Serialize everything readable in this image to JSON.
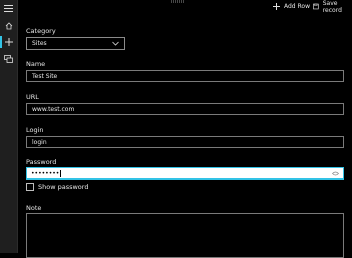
{
  "toolbar": {
    "add_row_label": "Add Row",
    "save_record_label": "Save record"
  },
  "sidebar": {
    "items": [
      {
        "name": "menu",
        "icon": "hamburger-menu-icon"
      },
      {
        "name": "home",
        "icon": "home-icon"
      },
      {
        "name": "add",
        "icon": "plus-icon",
        "selected": true
      },
      {
        "name": "records",
        "icon": "records-icon"
      }
    ]
  },
  "form": {
    "category": {
      "label": "Category",
      "value": "Sites"
    },
    "name": {
      "label": "Name",
      "value": "Test Site"
    },
    "url": {
      "label": "URL",
      "value": "www.test.com"
    },
    "login": {
      "label": "Login",
      "value": "login"
    },
    "password": {
      "label": "Password",
      "masked_value": "••••••••"
    },
    "show_password": {
      "label": "Show password",
      "checked": false
    },
    "note": {
      "label": "Note",
      "value": ""
    }
  },
  "colors": {
    "accent": "#33c3e6",
    "background": "#000000",
    "sidebar": "#1f1f1f"
  }
}
